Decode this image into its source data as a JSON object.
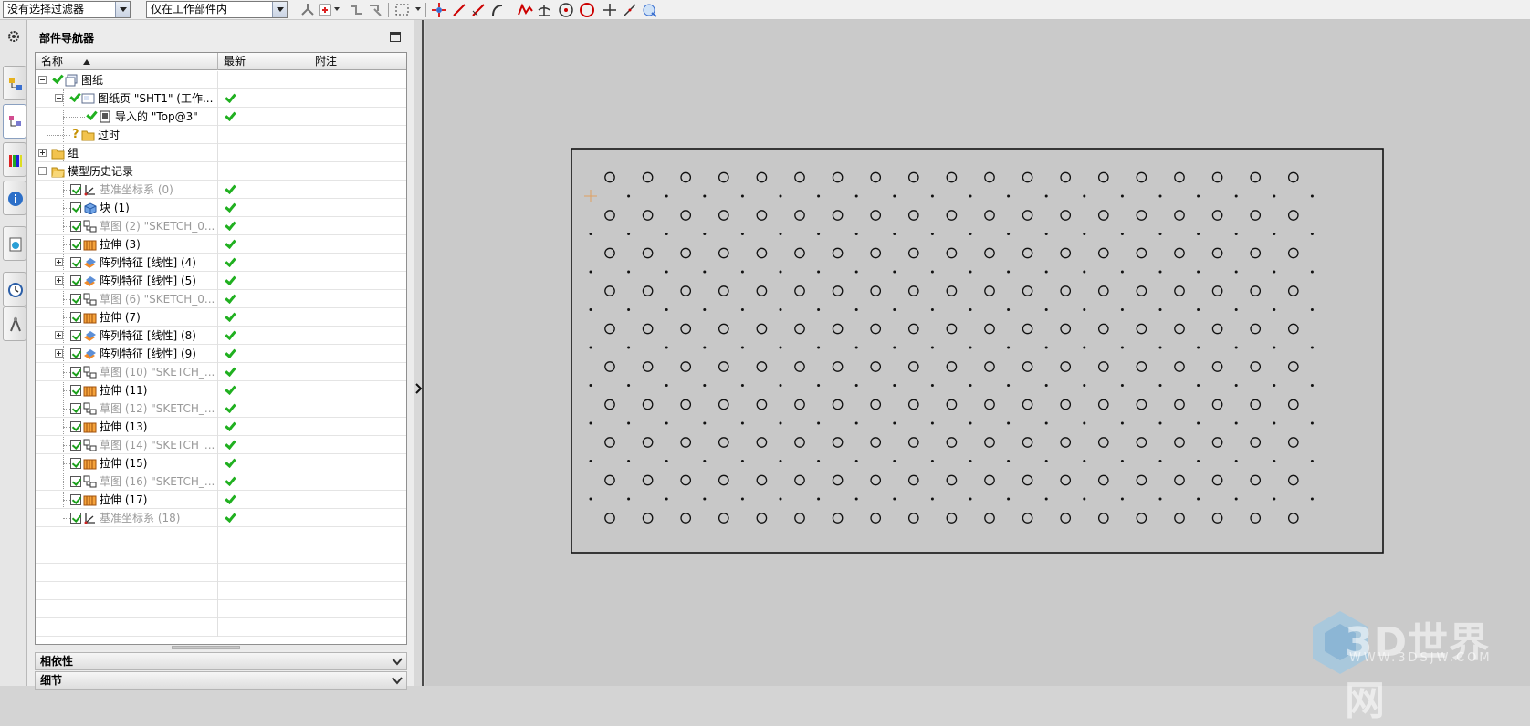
{
  "toolbar": {
    "filter_select": "没有选择过滤器",
    "scope_select": "仅在工作部件内",
    "icons": [
      "snap-point-icon",
      "add-point-icon",
      "select-chain-icon",
      "select-face-icon",
      "rectangle-select-icon",
      "point-constructor-icon",
      "line-icon",
      "line-2-icon",
      "arc-icon",
      "curve-icon",
      "perpendicular-icon",
      "circle-center-icon",
      "circle-icon",
      "cross-icon",
      "tangent-icon",
      "view-icon"
    ]
  },
  "resource_bar": {
    "icons": [
      "settings-gear-icon",
      "assembly-navigator-icon",
      "part-navigator-icon",
      "reuse-library-icon",
      "info-icon",
      "web-browser-icon",
      "history-clock-icon",
      "roles-icon"
    ]
  },
  "navigator": {
    "title": "部件导航器",
    "columns": [
      "名称",
      "最新",
      "附注"
    ],
    "rows": [
      {
        "label": "图纸",
        "latest": false,
        "gray": false
      },
      {
        "label": "图纸页 \"SHT1\" (工作...",
        "latest": true,
        "gray": false
      },
      {
        "label": "导入的 \"Top@3\"",
        "latest": true,
        "gray": false
      },
      {
        "label": "过时",
        "latest": false,
        "gray": false
      },
      {
        "label": "组",
        "latest": false,
        "gray": false
      },
      {
        "label": "模型历史记录",
        "latest": false,
        "gray": false
      },
      {
        "label": "基准坐标系 (0)",
        "latest": true,
        "gray": true
      },
      {
        "label": "块 (1)",
        "latest": true,
        "gray": false
      },
      {
        "label": "草图 (2) \"SKETCH_0...",
        "latest": true,
        "gray": true
      },
      {
        "label": "拉伸 (3)",
        "latest": true,
        "gray": false
      },
      {
        "label": "阵列特征 [线性] (4)",
        "latest": true,
        "gray": false
      },
      {
        "label": "阵列特征 [线性] (5)",
        "latest": true,
        "gray": false
      },
      {
        "label": "草图 (6) \"SKETCH_0...",
        "latest": true,
        "gray": true
      },
      {
        "label": "拉伸 (7)",
        "latest": true,
        "gray": false
      },
      {
        "label": "阵列特征 [线性] (8)",
        "latest": true,
        "gray": false
      },
      {
        "label": "阵列特征 [线性] (9)",
        "latest": true,
        "gray": false
      },
      {
        "label": "草图 (10) \"SKETCH_...",
        "latest": true,
        "gray": true
      },
      {
        "label": "拉伸 (11)",
        "latest": true,
        "gray": false
      },
      {
        "label": "草图 (12) \"SKETCH_...",
        "latest": true,
        "gray": true
      },
      {
        "label": "拉伸 (13)",
        "latest": true,
        "gray": false
      },
      {
        "label": "草图 (14) \"SKETCH_...",
        "latest": true,
        "gray": true
      },
      {
        "label": "拉伸 (15)",
        "latest": true,
        "gray": false
      },
      {
        "label": "草图 (16) \"SKETCH_...",
        "latest": true,
        "gray": true
      },
      {
        "label": "拉伸 (17)",
        "latest": true,
        "gray": false
      },
      {
        "label": "基准坐标系 (18)",
        "latest": true,
        "gray": true
      }
    ],
    "sections": [
      "相依性",
      "细节"
    ]
  },
  "canvas": {
    "hole_rows": 10,
    "hole_cols": 19,
    "dot_rows": 9,
    "dot_cols": 20
  },
  "watermark": {
    "text": "3D世界网",
    "sub": "WWW.3DSJW.COM"
  },
  "colors": {
    "check_green": "#20b020",
    "canvas_bg": "#cacaca",
    "sheet_bg": "#c8c8c8"
  }
}
